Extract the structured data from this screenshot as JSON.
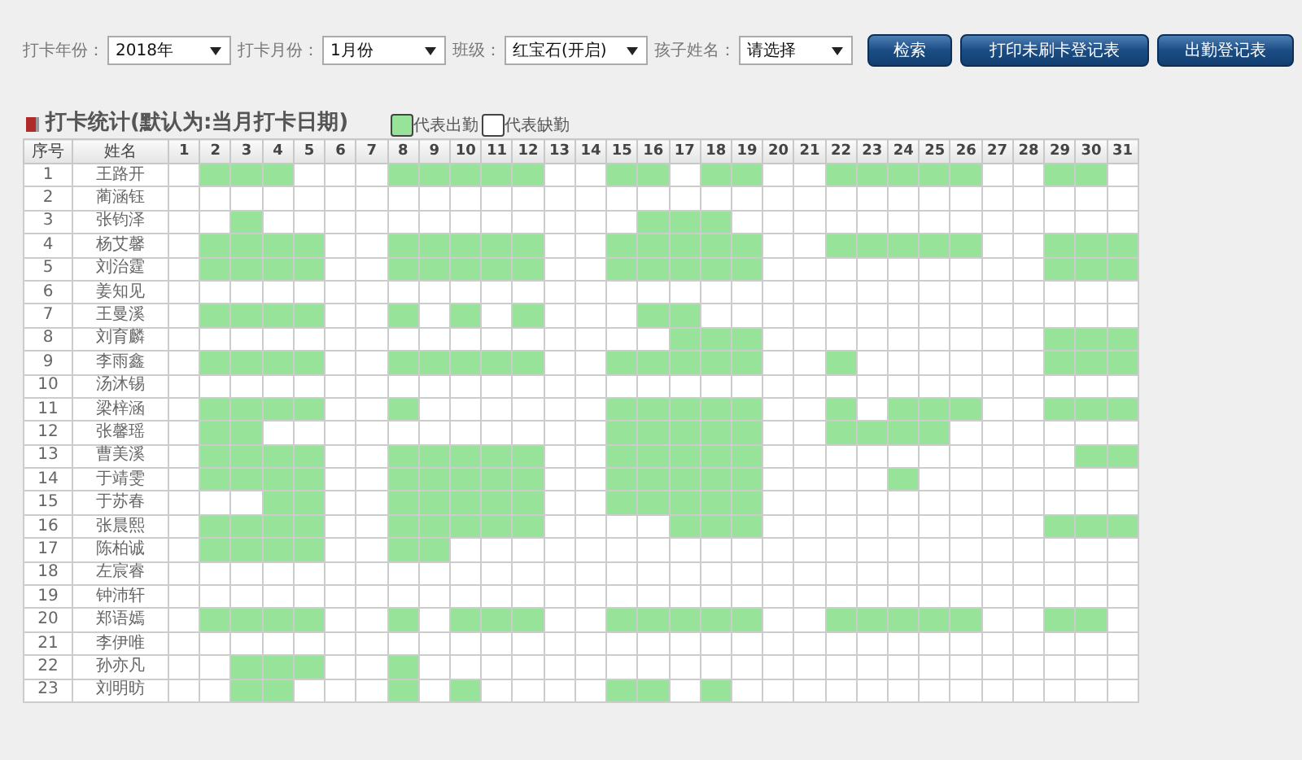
{
  "filters": [
    {
      "label": "打卡年份：",
      "value": "2018年"
    },
    {
      "label": "打卡月份：",
      "value": "1月份"
    },
    {
      "label": "班级：",
      "value": "红宝石(开启)"
    },
    {
      "label": "孩子姓名：",
      "value": "请选择"
    }
  ],
  "buttons": [
    "检索",
    "打印未刷卡登记表",
    "出勤登记表"
  ],
  "section_title": "打卡统计(默认为:当月打卡日期)",
  "legend": [
    {
      "kind": "present",
      "label": "代表出勤"
    },
    {
      "kind": "absent",
      "label": "代表缺勤"
    }
  ],
  "table": {
    "columns": [
      "序号",
      "姓名",
      "1",
      "2",
      "3",
      "4",
      "5",
      "6",
      "7",
      "8",
      "9",
      "10",
      "11",
      "12",
      "13",
      "14",
      "15",
      "16",
      "17",
      "18",
      "19",
      "20",
      "21",
      "22",
      "23",
      "24",
      "25",
      "26",
      "27",
      "28",
      "29",
      "30",
      "31"
    ],
    "rows": [
      {
        "no": "1",
        "name": "王路开",
        "present": [
          false,
          true,
          true,
          true,
          false,
          false,
          false,
          true,
          true,
          true,
          true,
          true,
          false,
          false,
          true,
          true,
          false,
          true,
          true,
          false,
          false,
          true,
          true,
          true,
          true,
          true,
          false,
          false,
          true,
          true,
          false
        ]
      },
      {
        "no": "2",
        "name": "蔺涵钰",
        "present": [
          false,
          false,
          false,
          false,
          false,
          false,
          false,
          false,
          false,
          false,
          false,
          false,
          false,
          false,
          false,
          false,
          false,
          false,
          false,
          false,
          false,
          false,
          false,
          false,
          false,
          false,
          false,
          false,
          false,
          false,
          false
        ]
      },
      {
        "no": "3",
        "name": "张钧泽",
        "present": [
          false,
          false,
          true,
          false,
          false,
          false,
          false,
          false,
          false,
          false,
          false,
          false,
          false,
          false,
          false,
          true,
          true,
          true,
          false,
          false,
          false,
          false,
          false,
          false,
          false,
          false,
          false,
          false,
          false,
          false,
          false
        ]
      },
      {
        "no": "4",
        "name": "杨艾馨",
        "present": [
          false,
          true,
          true,
          true,
          true,
          false,
          false,
          true,
          true,
          true,
          true,
          true,
          false,
          false,
          true,
          true,
          true,
          true,
          true,
          false,
          false,
          true,
          true,
          true,
          true,
          true,
          false,
          false,
          true,
          true,
          true
        ]
      },
      {
        "no": "5",
        "name": "刘治霆",
        "present": [
          false,
          true,
          true,
          true,
          true,
          false,
          false,
          true,
          true,
          true,
          true,
          true,
          false,
          false,
          true,
          true,
          true,
          true,
          true,
          false,
          false,
          false,
          false,
          false,
          false,
          false,
          false,
          false,
          true,
          true,
          true
        ]
      },
      {
        "no": "6",
        "name": "姜知见",
        "present": [
          false,
          false,
          false,
          false,
          false,
          false,
          false,
          false,
          false,
          false,
          false,
          false,
          false,
          false,
          false,
          false,
          false,
          false,
          false,
          false,
          false,
          false,
          false,
          false,
          false,
          false,
          false,
          false,
          false,
          false,
          false
        ]
      },
      {
        "no": "7",
        "name": "王曼溪",
        "present": [
          false,
          true,
          true,
          true,
          true,
          false,
          false,
          true,
          false,
          true,
          false,
          true,
          false,
          false,
          false,
          true,
          true,
          false,
          false,
          false,
          false,
          false,
          false,
          false,
          false,
          false,
          false,
          false,
          false,
          false,
          false
        ]
      },
      {
        "no": "8",
        "name": "刘育麟",
        "present": [
          false,
          false,
          false,
          false,
          false,
          false,
          false,
          false,
          false,
          false,
          false,
          false,
          false,
          false,
          false,
          false,
          true,
          true,
          true,
          false,
          false,
          false,
          false,
          false,
          false,
          false,
          false,
          false,
          true,
          true,
          true
        ]
      },
      {
        "no": "9",
        "name": "李雨鑫",
        "present": [
          false,
          true,
          true,
          true,
          true,
          false,
          false,
          true,
          true,
          true,
          true,
          true,
          false,
          false,
          true,
          true,
          true,
          true,
          true,
          false,
          false,
          true,
          false,
          false,
          false,
          false,
          false,
          false,
          true,
          true,
          true
        ]
      },
      {
        "no": "10",
        "name": "汤沐锡",
        "present": [
          false,
          false,
          false,
          false,
          false,
          false,
          false,
          false,
          false,
          false,
          false,
          false,
          false,
          false,
          false,
          false,
          false,
          false,
          false,
          false,
          false,
          false,
          false,
          false,
          false,
          false,
          false,
          false,
          false,
          false,
          false
        ]
      },
      {
        "no": "11",
        "name": "梁梓涵",
        "present": [
          false,
          true,
          true,
          true,
          true,
          false,
          false,
          true,
          false,
          false,
          false,
          false,
          false,
          false,
          true,
          true,
          true,
          true,
          true,
          false,
          false,
          true,
          false,
          true,
          true,
          true,
          false,
          false,
          true,
          true,
          true
        ]
      },
      {
        "no": "12",
        "name": "张馨瑶",
        "present": [
          false,
          true,
          true,
          false,
          false,
          false,
          false,
          false,
          false,
          false,
          false,
          false,
          false,
          false,
          true,
          true,
          true,
          true,
          true,
          false,
          false,
          true,
          true,
          true,
          true,
          false,
          false,
          false,
          false,
          false,
          false
        ]
      },
      {
        "no": "13",
        "name": "曹美溪",
        "present": [
          false,
          true,
          true,
          true,
          true,
          false,
          false,
          true,
          true,
          true,
          true,
          true,
          false,
          false,
          true,
          true,
          true,
          true,
          true,
          false,
          false,
          false,
          false,
          false,
          false,
          false,
          false,
          false,
          false,
          true,
          true
        ]
      },
      {
        "no": "14",
        "name": "于靖雯",
        "present": [
          false,
          true,
          true,
          true,
          true,
          false,
          false,
          true,
          true,
          true,
          true,
          true,
          false,
          false,
          true,
          true,
          true,
          true,
          true,
          false,
          false,
          false,
          false,
          true,
          false,
          false,
          false,
          false,
          false,
          false,
          false
        ]
      },
      {
        "no": "15",
        "name": "于苏春",
        "present": [
          false,
          false,
          false,
          true,
          true,
          false,
          false,
          true,
          true,
          true,
          true,
          true,
          false,
          false,
          true,
          true,
          true,
          true,
          true,
          false,
          false,
          false,
          false,
          false,
          false,
          false,
          false,
          false,
          false,
          false,
          false
        ]
      },
      {
        "no": "16",
        "name": "张晨熙",
        "present": [
          false,
          true,
          true,
          true,
          true,
          false,
          false,
          true,
          true,
          true,
          true,
          true,
          false,
          false,
          false,
          false,
          true,
          true,
          true,
          false,
          false,
          false,
          false,
          false,
          false,
          false,
          false,
          false,
          true,
          true,
          true
        ]
      },
      {
        "no": "17",
        "name": "陈柏诚",
        "present": [
          false,
          true,
          true,
          true,
          true,
          false,
          false,
          true,
          true,
          false,
          false,
          false,
          false,
          false,
          false,
          false,
          false,
          false,
          false,
          false,
          false,
          false,
          false,
          false,
          false,
          false,
          false,
          false,
          false,
          false,
          false
        ]
      },
      {
        "no": "18",
        "name": "左宸睿",
        "present": [
          false,
          false,
          false,
          false,
          false,
          false,
          false,
          false,
          false,
          false,
          false,
          false,
          false,
          false,
          false,
          false,
          false,
          false,
          false,
          false,
          false,
          false,
          false,
          false,
          false,
          false,
          false,
          false,
          false,
          false,
          false
        ]
      },
      {
        "no": "19",
        "name": "钟沛轩",
        "present": [
          false,
          false,
          false,
          false,
          false,
          false,
          false,
          false,
          false,
          false,
          false,
          false,
          false,
          false,
          false,
          false,
          false,
          false,
          false,
          false,
          false,
          false,
          false,
          false,
          false,
          false,
          false,
          false,
          false,
          false,
          false
        ]
      },
      {
        "no": "20",
        "name": "郑语嫣",
        "present": [
          false,
          true,
          true,
          true,
          true,
          false,
          false,
          true,
          false,
          true,
          true,
          true,
          false,
          false,
          true,
          true,
          true,
          true,
          true,
          false,
          false,
          true,
          true,
          true,
          true,
          true,
          false,
          false,
          true,
          true,
          false
        ]
      },
      {
        "no": "21",
        "name": "李伊唯",
        "present": [
          false,
          false,
          false,
          false,
          false,
          false,
          false,
          false,
          false,
          false,
          false,
          false,
          false,
          false,
          false,
          false,
          false,
          false,
          false,
          false,
          false,
          false,
          false,
          false,
          false,
          false,
          false,
          false,
          false,
          false,
          false
        ]
      },
      {
        "no": "22",
        "name": "孙亦凡",
        "present": [
          false,
          false,
          true,
          true,
          true,
          false,
          false,
          true,
          false,
          false,
          false,
          false,
          false,
          false,
          false,
          false,
          false,
          false,
          false,
          false,
          false,
          false,
          false,
          false,
          false,
          false,
          false,
          false,
          false,
          false,
          false
        ]
      },
      {
        "no": "23",
        "name": "刘明昉",
        "present": [
          false,
          false,
          true,
          true,
          false,
          false,
          false,
          true,
          false,
          true,
          false,
          false,
          false,
          false,
          true,
          true,
          false,
          true,
          false,
          false,
          false,
          false,
          false,
          false,
          false,
          false,
          false,
          false,
          false,
          false,
          false
        ]
      }
    ]
  }
}
